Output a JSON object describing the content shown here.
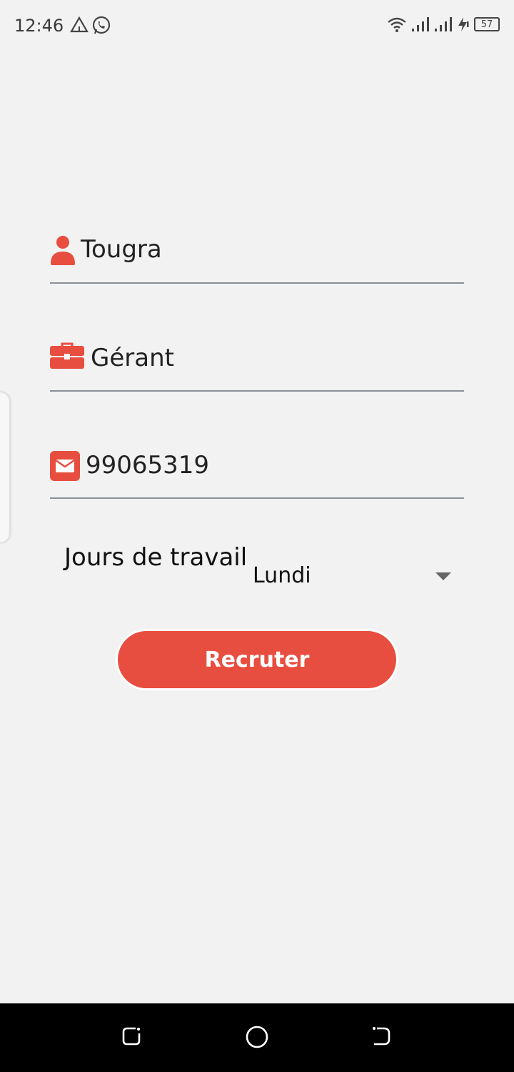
{
  "status_bar": {
    "time": "12:46",
    "battery": "57",
    "left_icons": [
      "alert-triangle-icon",
      "whatsapp-icon"
    ],
    "right_icons": [
      "wifi-icon",
      "signal-icon",
      "signal-icon",
      "charging-icon",
      "battery-icon"
    ]
  },
  "form": {
    "name": {
      "value": "Tougra",
      "icon": "person-icon"
    },
    "role": {
      "value": "Gérant",
      "icon": "briefcase-icon"
    },
    "phone": {
      "value": "99065319",
      "icon": "envelope-icon"
    },
    "workdays": {
      "label": "Jours de travail",
      "selected": "Lundi"
    },
    "submit_label": "Recruter"
  },
  "colors": {
    "accent": "#e84e3f",
    "background": "#f2f2f2",
    "underline": "#8a9096"
  },
  "nav_bar": {
    "buttons": [
      "recent-apps-icon",
      "home-icon",
      "back-icon"
    ]
  }
}
